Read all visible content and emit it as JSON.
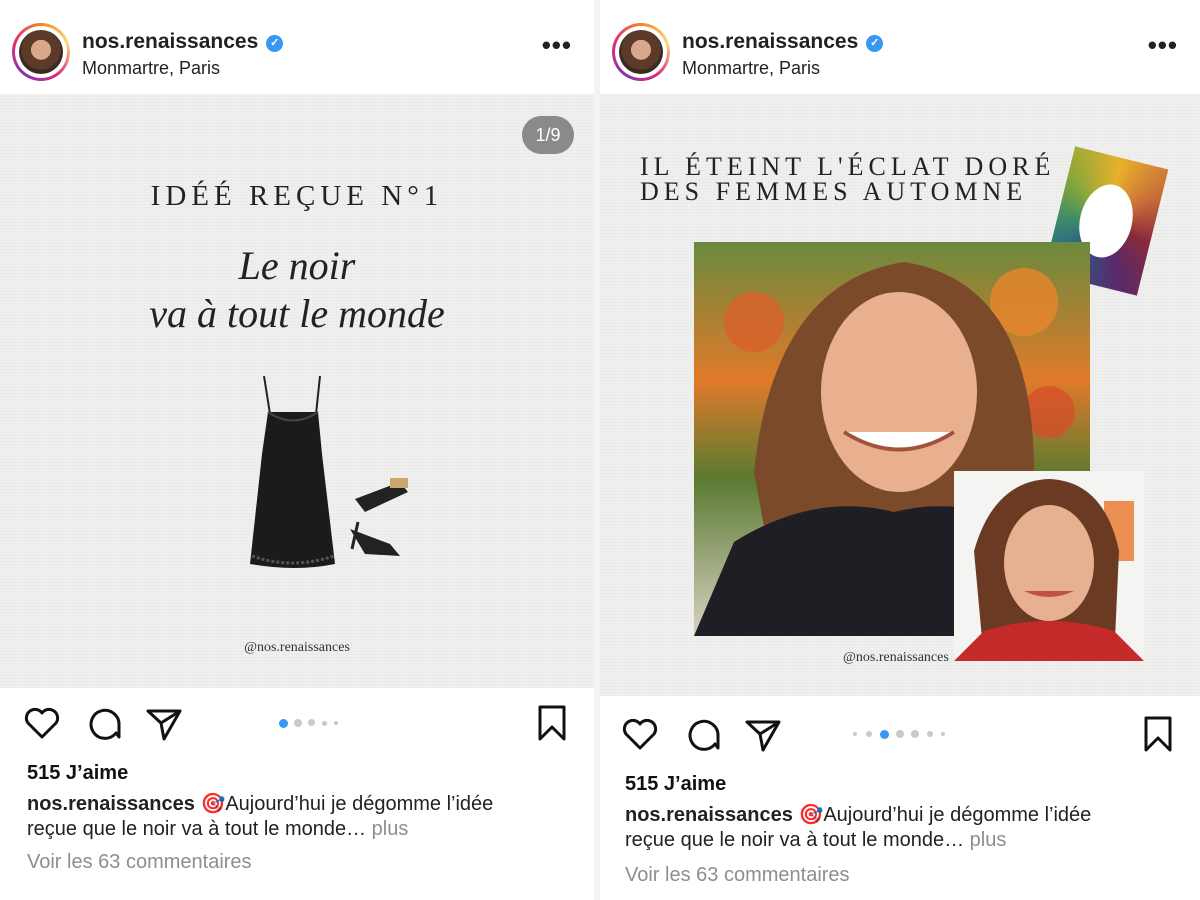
{
  "left_post": {
    "username": "nos.renaissances",
    "location": "Monmartre, Paris",
    "slide": {
      "counter": "1/9",
      "kicker": "IDÉÉ REÇUE N°1",
      "title_line1": "Le noir",
      "title_line2": "va à tout le monde",
      "handle": "@nos.renaissances"
    },
    "likes": "515 J’aime",
    "caption_user": "nos.renaissances",
    "caption_emoji": "🎯",
    "caption_text_line1": "Aujourd’hui je dégomme l’idée",
    "caption_text_line2": "reçue que le noir va à tout le monde…",
    "more_label": "plus",
    "comments_link": "Voir les 63 commentaires"
  },
  "right_post": {
    "username": "nos.renaissances",
    "location": "Monmartre, Paris",
    "slide": {
      "title_line1": "IL ÉTEINT L'ÉCLAT DORÉ",
      "title_line2": "DES FEMMES AUTOMNE",
      "handle": "@nos.renaissances"
    },
    "likes": "515 J’aime",
    "caption_user": "nos.renaissances",
    "caption_emoji": "🎯",
    "caption_text_line1": "Aujourd’hui je dégomme l’idée",
    "caption_text_line2": "reçue que le noir va à tout le monde…",
    "more_label": "plus",
    "comments_link": "Voir les 63 commentaires"
  },
  "colors": {
    "accent_blue": "#3897f0",
    "muted_text": "#8e8e8e",
    "slide_background": "#f0f0ee"
  },
  "icons": [
    "heart-icon",
    "comment-icon",
    "share-icon",
    "bookmark-icon",
    "more-icon",
    "verified-icon"
  ]
}
